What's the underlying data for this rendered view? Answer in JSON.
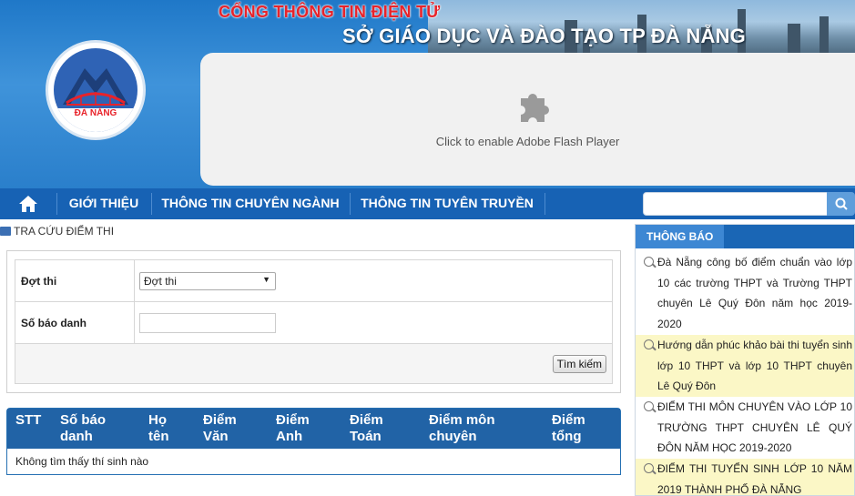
{
  "header": {
    "portal_title": "CỔNG THÔNG TIN ĐIỆN TỬ",
    "department_title": "SỞ GIÁO DỤC VÀ ĐÀO TẠO TP ĐÀ NẴNG",
    "logo_text": "ĐÀ NẴNG",
    "flash_text": "Click to enable Adobe Flash Player"
  },
  "nav": {
    "items": [
      "GIỚI THIỆU",
      "THÔNG TIN CHUYÊN NGÀNH",
      "THÔNG TIN TUYÊN TRUYỀN"
    ],
    "search_placeholder": ""
  },
  "breadcrumb": "TRA CỨU ĐIỂM THI",
  "form": {
    "exam_label": "Đợt thi",
    "exam_selected": "Đợt thi",
    "candidate_label": "Số báo danh",
    "candidate_value": "",
    "submit_label": "Tìm kiếm"
  },
  "results": {
    "columns": [
      "STT",
      "Số báo danh",
      "Họ tên",
      "Điểm Văn",
      "Điểm Anh",
      "Điểm Toán",
      "Điểm môn chuyên",
      "Điểm tổng"
    ],
    "empty_message": "Không tìm thấy thí sinh nào"
  },
  "sidebar": {
    "title": "THÔNG BÁO",
    "news": [
      "Đà Nẵng công bố điểm chuẩn vào lớp 10 các trường THPT và Trường THPT chuyên Lê Quý Đôn năm học 2019-2020",
      "Hướng dẫn phúc khảo bài thi tuyển sinh lớp 10 THPT và lớp 10 THPT chuyên Lê Quý Đôn",
      "ĐIỂM THI MÔN CHUYÊN VÀO LỚP 10 TRƯỜNG THPT CHUYÊN LÊ QUÝ ĐÔN NĂM HỌC 2019-2020",
      "ĐIỂM THI TUYỂN SINH LỚP 10 NĂM 2019 THÀNH PHỐ ĐÀ NẴNG"
    ]
  },
  "colors": {
    "nav_bg": "#1762b4",
    "header_bg": "#2a7fcb",
    "table_head": "#2163a6",
    "highlight_row": "#fbf7c6",
    "portal_title_red": "#e8232a"
  }
}
